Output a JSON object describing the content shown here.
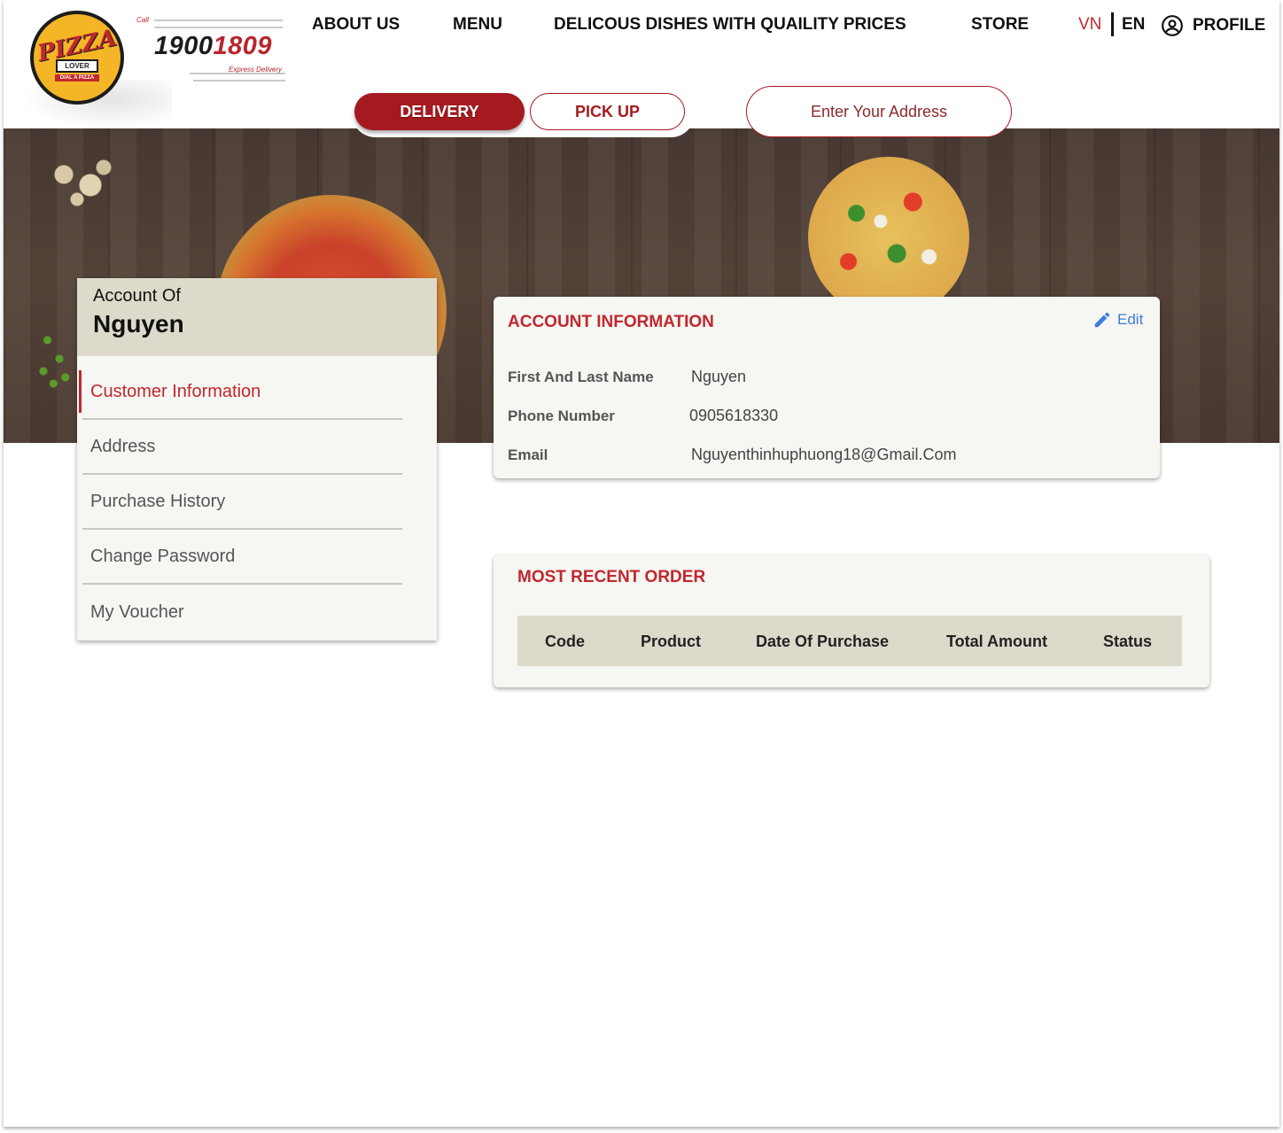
{
  "brand": {
    "logo_text": "PIZZA",
    "logo_sub": "LOVER",
    "logo_tag": "DIAL A PIZZA",
    "call_label": "Call",
    "hotline_a": "1900",
    "hotline_b": "1809",
    "express": "Express Delivery"
  },
  "nav": {
    "items": [
      "ABOUT US",
      "MENU",
      "DELICOUS DISHES WITH QUAILITY PRICES",
      "STORE"
    ],
    "lang_vn": "VN",
    "lang_en": "EN",
    "profile": "PROFILE"
  },
  "order_type": {
    "delivery": "DELIVERY",
    "pickup": "PICK UP",
    "address_placeholder": "Enter Your Address"
  },
  "sidebar": {
    "account_label": "Account Of",
    "account_name": "Nguyen",
    "items": [
      {
        "label": "Customer Information",
        "active": true
      },
      {
        "label": "Address"
      },
      {
        "label": "Purchase History"
      },
      {
        "label": "Change Password"
      },
      {
        "label": "My Voucher"
      }
    ]
  },
  "account_info": {
    "title": "ACCOUNT INFORMATION",
    "edit_label": "Edit",
    "fields": [
      {
        "label": "First And Last Name",
        "value": "Nguyen"
      },
      {
        "label": "Phone Number",
        "value": "0905618330"
      },
      {
        "label": "Email",
        "value": "Nguyenthinhuphuong18@Gmail.Com"
      }
    ]
  },
  "recent_order": {
    "title": "MOST RECENT ORDER",
    "columns": [
      "Code",
      "Product",
      "Date Of Purchase",
      "Total Amount",
      "Status"
    ]
  },
  "colors": {
    "brand_red": "#a51a1f",
    "accent_red": "#c1272d",
    "panel": "#f6f6f2",
    "panel_head": "#dedacb",
    "link_blue": "#3d7be0"
  }
}
